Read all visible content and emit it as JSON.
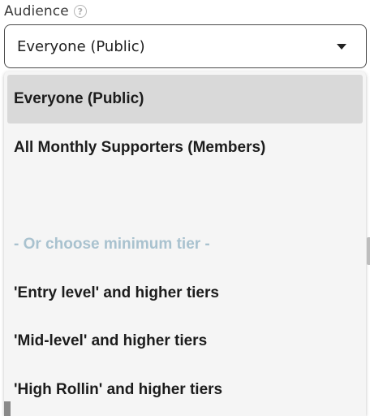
{
  "audience": {
    "label": "Audience",
    "help_icon": "?",
    "selected_value": "Everyone (Public)"
  },
  "dropdown": {
    "options": [
      {
        "label": "Everyone (Public)",
        "selected": true
      },
      {
        "label": "All Monthly Supporters (Members)",
        "selected": false
      },
      {
        "label": "",
        "selected": false
      },
      {
        "label": "- Or choose minimum tier -",
        "selected": false,
        "disabled": true
      },
      {
        "label": "'Entry level' and higher tiers",
        "selected": false
      },
      {
        "label": "'Mid-level' and higher tiers",
        "selected": false
      },
      {
        "label": "'High Rollin' and higher tiers",
        "selected": false
      }
    ]
  },
  "colors": {
    "selected_option_bg": "#d9d9d9",
    "group_label": "#a9c2cf",
    "dropdown_bg": "#f5f5f5"
  }
}
